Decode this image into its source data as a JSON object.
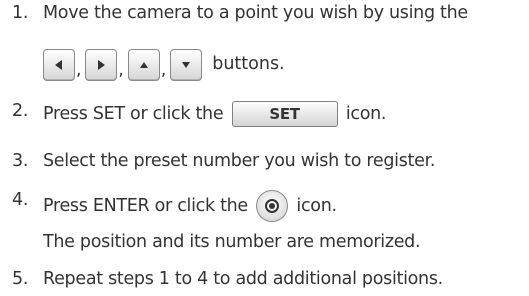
{
  "steps": [
    {
      "number": "1.",
      "text": "Move the camera to a point you wish by using the",
      "separators": [
        ",",
        ",",
        ","
      ],
      "after_buttons": "buttons."
    },
    {
      "number": "2.",
      "before": "Press SET or click the",
      "button_label": "SET",
      "after": "icon."
    },
    {
      "number": "3.",
      "text": "Select the preset number you wish to register."
    },
    {
      "number": "4.",
      "before": "Press ENTER or click the",
      "after": "icon.",
      "note": "The position and its number are memorized."
    },
    {
      "number": "5.",
      "text": "Repeat steps 1 to 4 to add additional positions."
    }
  ],
  "icons": [
    "left-arrow-icon",
    "right-arrow-icon",
    "up-arrow-icon",
    "down-arrow-icon",
    "set-button-icon",
    "enter-button-icon"
  ]
}
